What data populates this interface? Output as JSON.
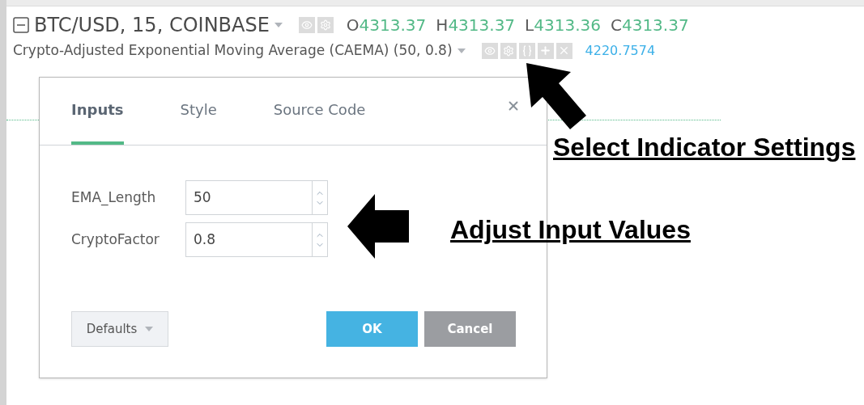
{
  "symbol": {
    "title": "BTC/USD, 15, COINBASE",
    "ohlc": [
      {
        "label": "O",
        "value": "4313.37"
      },
      {
        "label": "H",
        "value": "4313.37"
      },
      {
        "label": "L",
        "value": "4313.36"
      },
      {
        "label": "C",
        "value": "4313.37"
      }
    ]
  },
  "indicator": {
    "title": "Crypto-Adjusted Exponential Moving Average (CAEMA) (50, 0.8)",
    "value": "4220.7574"
  },
  "dialog": {
    "tabs": [
      {
        "label": "Inputs",
        "selected": true
      },
      {
        "label": "Style",
        "selected": false
      },
      {
        "label": "Source Code",
        "selected": false
      }
    ],
    "inputs": [
      {
        "label": "EMA_Length",
        "value": "50"
      },
      {
        "label": "CryptoFactor",
        "value": "0.8"
      }
    ],
    "defaults_button": "Defaults",
    "ok_button": "OK",
    "cancel_button": "Cancel"
  },
  "annotations": [
    {
      "text": "Select Indicator Settings"
    },
    {
      "text": "Adjust Input Values"
    }
  ]
}
